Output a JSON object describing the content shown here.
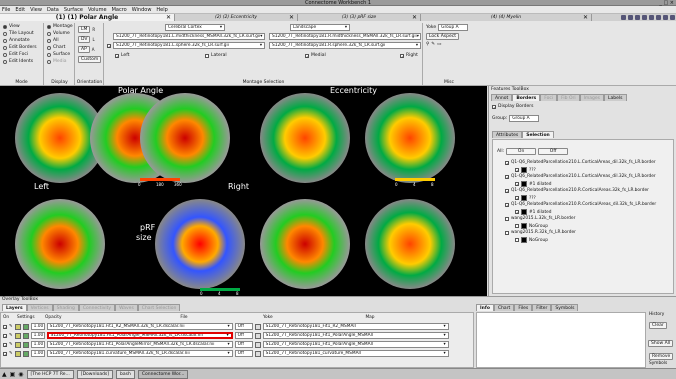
{
  "window": {
    "title": "Connectome Workbench 1",
    "controls": "_ □ ×"
  },
  "menu": [
    "File",
    "Edit",
    "View",
    "Data",
    "Surface",
    "Volume",
    "Macro",
    "Window",
    "Help"
  ],
  "tabs": [
    {
      "label": "(1) (1) Polar Angle",
      "active": true
    },
    {
      "label": "(2) (2) Eccentricity",
      "active": false
    },
    {
      "label": "(3) (3) pRF size",
      "active": false
    },
    {
      "label": "(4) (4) Myelin",
      "active": false
    }
  ],
  "tab_close": "✕",
  "toolbar": {
    "mode": {
      "label": "Mode",
      "options": [
        "View",
        "Tile Layout",
        "Annotate",
        "Edit Borders",
        "Edit Foci",
        "Edit Idents"
      ],
      "selected": "View"
    },
    "display": {
      "label": "Display",
      "options": [
        "Montage",
        "Volume",
        "All",
        "Chart",
        "Surface",
        "Media"
      ],
      "selected": "Montage"
    },
    "orientation": {
      "label": "Orientation",
      "buttons": [
        "LM",
        "DV",
        "AP",
        "Custom"
      ],
      "right_buttons": [
        "R",
        "L",
        "A",
        "P"
      ]
    },
    "montage": {
      "label": "Montage Selection",
      "structure": "Cerebral Cortex",
      "layout": "Landscape",
      "left_files": [
        "S1200_7T_Retinotopy181.L.midthickness_MSMAll.32k_fs_LR.surf.gii",
        "S1200_7T_Retinotopy181.L.sphere.32k_fs_LR.surf.gii"
      ],
      "right_files": [
        "S1200_7T_Retinotopy181.R.midthickness_MSMAll.32k_fs_LR.surf.gii",
        "S1200_7T_Retinotopy181.R.sphere.32k_fs_LR.surf.gii"
      ],
      "checks": [
        "Left",
        "Lateral",
        "Medial",
        "Right"
      ]
    },
    "misc": {
      "label": "Misc",
      "yoke_label": "Yoke",
      "yoke_value": "Group A",
      "lock": "Lock Aspect"
    }
  },
  "viewport": {
    "polar": "Polar Angle",
    "ecc": "Eccentricity",
    "left": "Left",
    "right": "Right",
    "prf": "pRF",
    "size": "size",
    "scale_polar": [
      "0",
      "180",
      "360"
    ],
    "scale_ecc": [
      "0",
      "4",
      "8"
    ],
    "scale_prf": [
      "0",
      "4",
      "8"
    ]
  },
  "features": {
    "title": "Features ToolBox",
    "tabs": [
      "Annot",
      "Borders",
      "Foci",
      "Fib Ori",
      "Images",
      "Labels"
    ],
    "display_borders": "Display Borders",
    "group_label": "Group:",
    "group_value": "Group A",
    "subtabs": [
      "Attributes",
      "Selection"
    ],
    "all_label": "All:",
    "on": "On",
    "off": "Off",
    "tree": [
      "Q1-Q6_RelatedParcellation210.L.CorticalAreas_dil.32k_fs_LR.border",
      "???",
      "Q1-Q6_RelatedParcellation210.L.CorticalAreas_dil.32k_fs_LR.border",
      "#1 dilated",
      "Q1-Q6_RelatedParcellation210.R.CorticalAreas.32k_fs_LR.border",
      "???",
      "Q1-Q6_RelatedParcellation210.R.CorticalAreas_dil.32k_fs_LR.border",
      "#1 dilated",
      "wang2015.L.32k_fs_LR.border",
      "NoGroup",
      "wang2015.R.32k_fs_LR.border",
      "NoGroup"
    ]
  },
  "overlay": {
    "title": "Overlay ToolBox",
    "tabs": [
      "Layers",
      "Vertices",
      "Shading",
      "Connectivity",
      "Waves",
      "Chart Selection"
    ],
    "headers": [
      "On",
      "Settings",
      "Opacity",
      "File",
      "Yoke",
      "Map"
    ],
    "rows": [
      {
        "opacity": "1.00",
        "file": "S1200_7T_Retinotopy181.Fit1_R2_MSMAll.32k_fs_LR.dscalar.nii",
        "yoke": "Off",
        "map": "S1200_7T_Retinotopy181_Fit1_R2_MSMAll"
      },
      {
        "opacity": "1.00",
        "file": "S1200_7T_Retinotopy181.Fit1_PolarAngle_MSMAll.32k_fs_LR.dscalar.nii",
        "yoke": "Off",
        "map": "S1200_7T_Retinotopy181_Fit1_PolarAngle_MSMAll"
      },
      {
        "opacity": "1.00",
        "file": "S1200_7T_Retinotopy181.Fit1_PolarAngleMirror_MSMAll.32k_fs_LR.dscalar.nii",
        "yoke": "Off",
        "map": "S1200_7T_Retinotopy181_Fit1_PolarAngle_MSMAll"
      },
      {
        "opacity": "1.00",
        "file": "S1200_7T_Retinotopy181.curvature_MSMAll.32k_fs_LR.dscalar.nii",
        "yoke": "Off",
        "map": "S1200_7T_Retinotopy181_curvature_MSMAll"
      }
    ],
    "info_tabs": [
      "Info",
      "Chart",
      "Files",
      "Filter",
      "Symbols"
    ],
    "history": "History",
    "clear": "Clear",
    "show_all": "Show All",
    "remove": "Remove",
    "symbols": "Symbols"
  },
  "taskbar": [
    "[The HCP 7T Re...",
    "[Downloads]",
    "bash",
    "Connectome Wor..."
  ],
  "colors": {
    "highlight": "#e00000",
    "viewport_bg": "#000000"
  }
}
